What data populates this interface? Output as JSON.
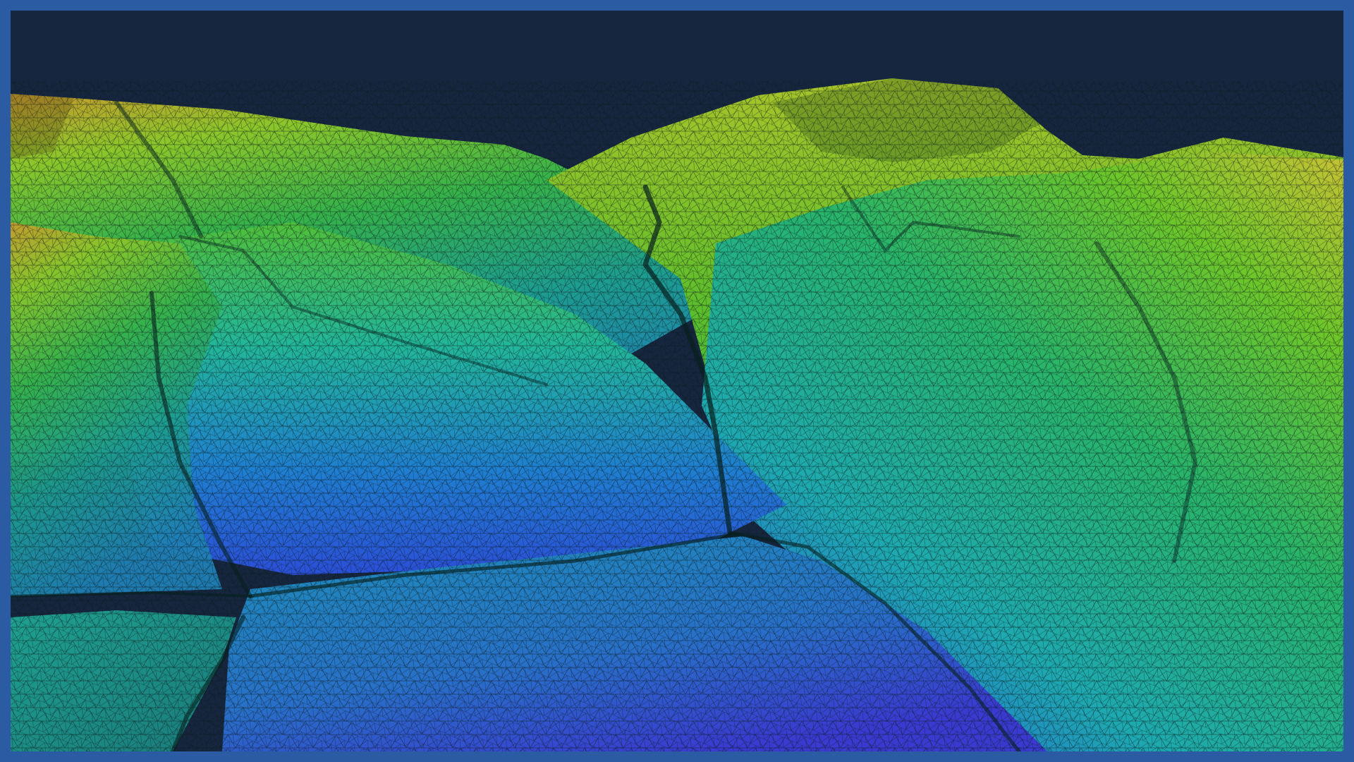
{
  "scene": {
    "description_kind": "terrain-mesh-render",
    "colors": {
      "frame_border": "#2b5ba3",
      "sky": "#16263f",
      "ridge_high": "#c8a030",
      "ridge_mid": "#5fc02a",
      "slope": "#1fb59a",
      "valley": "#2a6fd8",
      "valley_deep": "#3a3ad0",
      "mesh_line": "#0a1a1a"
    }
  }
}
